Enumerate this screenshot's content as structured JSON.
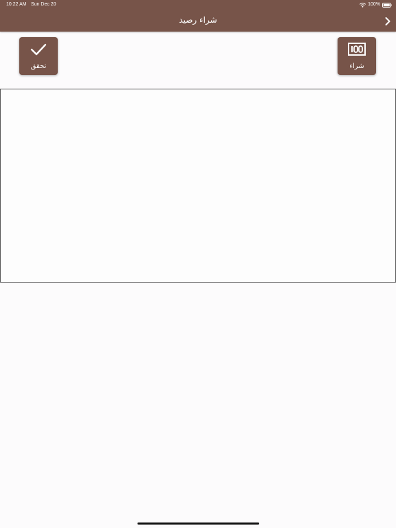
{
  "status_bar": {
    "time": "10:22 AM",
    "date": "Sun Dec 20",
    "battery": "100%"
  },
  "nav": {
    "title": "شراء رصيد",
    "back_icon": "chevron-right-icon"
  },
  "actions": {
    "verify": {
      "label": "تحقق",
      "icon": "checkmark-icon"
    },
    "buy": {
      "label": "شراء",
      "icon": "card-100-icon"
    }
  },
  "colors": {
    "brand": "#775449",
    "background": "#fcfbfc",
    "on_brand": "#ffffff"
  }
}
